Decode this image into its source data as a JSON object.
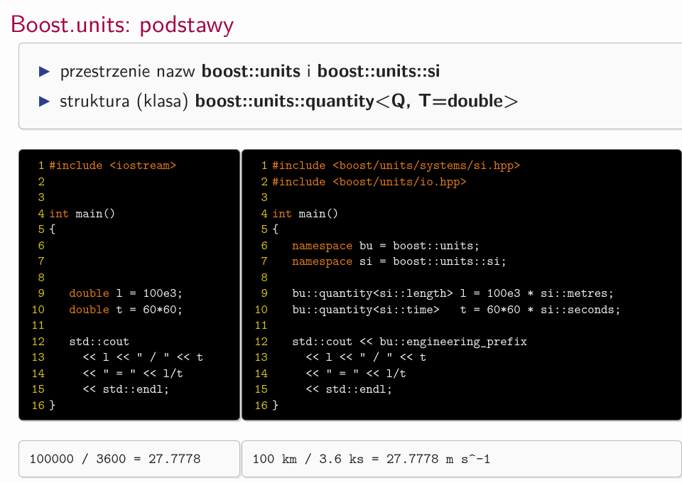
{
  "title": "Boost.units: podstawy",
  "bullets": {
    "b1_pre": "przestrzenie nazw ",
    "b1_bold_a": "boost::units",
    "b1_mid": " i ",
    "b1_bold_b": "boost::units::si",
    "b2_pre": "struktura (klasa) ",
    "b2_bold": "boost::units::quantity<Q, T=double>"
  },
  "code_left_lines": [
    {
      "n": "1",
      "kind": "kw",
      "text": "#include <iostream>"
    },
    {
      "n": "2",
      "kind": "txt",
      "text": ""
    },
    {
      "n": "3",
      "kind": "txt",
      "text": ""
    },
    {
      "n": "4",
      "kind": "mix",
      "pre_kw": "int",
      "rest": " main()"
    },
    {
      "n": "5",
      "kind": "txt",
      "text": "{"
    },
    {
      "n": "6",
      "kind": "txt",
      "text": ""
    },
    {
      "n": "7",
      "kind": "txt",
      "text": ""
    },
    {
      "n": "8",
      "kind": "txt",
      "text": ""
    },
    {
      "n": "9",
      "kind": "mix",
      "pre": "   ",
      "pre_kw": "double",
      "rest": " l = 100e3;"
    },
    {
      "n": "10",
      "kind": "mix",
      "pre": "   ",
      "pre_kw": "double",
      "rest": " t = 60*60;"
    },
    {
      "n": "11",
      "kind": "txt",
      "text": ""
    },
    {
      "n": "12",
      "kind": "txt",
      "text": "   std::cout"
    },
    {
      "n": "13",
      "kind": "txt",
      "text": "     << l << \" / \" << t"
    },
    {
      "n": "14",
      "kind": "txt",
      "text": "     << \" = \" << l/t"
    },
    {
      "n": "15",
      "kind": "txt",
      "text": "     << std::endl;"
    },
    {
      "n": "16",
      "kind": "txt",
      "text": "}"
    }
  ],
  "code_right_lines": [
    {
      "n": "1",
      "kind": "kw",
      "text": "#include <boost/units/systems/si.hpp>"
    },
    {
      "n": "2",
      "kind": "kw",
      "text": "#include <boost/units/io.hpp>"
    },
    {
      "n": "3",
      "kind": "txt",
      "text": ""
    },
    {
      "n": "4",
      "kind": "mix",
      "pre_kw": "int",
      "rest": " main()"
    },
    {
      "n": "5",
      "kind": "txt",
      "text": "{"
    },
    {
      "n": "6",
      "kind": "mix",
      "pre": "   ",
      "pre_kw": "namespace",
      "rest": " bu = boost::units;"
    },
    {
      "n": "7",
      "kind": "mix",
      "pre": "   ",
      "pre_kw": "namespace",
      "rest": " si = boost::units::si;"
    },
    {
      "n": "8",
      "kind": "txt",
      "text": ""
    },
    {
      "n": "9",
      "kind": "txt",
      "text": "   bu::quantity<si::length> l = 100e3 * si::metres;"
    },
    {
      "n": "10",
      "kind": "txt",
      "text": "   bu::quantity<si::time>   t = 60*60 * si::seconds;"
    },
    {
      "n": "11",
      "kind": "txt",
      "text": ""
    },
    {
      "n": "12",
      "kind": "txt",
      "text": "   std::cout << bu::engineering_prefix"
    },
    {
      "n": "13",
      "kind": "txt",
      "text": "     << l << \" / \" << t"
    },
    {
      "n": "14",
      "kind": "txt",
      "text": "     << \" = \" << l/t"
    },
    {
      "n": "15",
      "kind": "txt",
      "text": "     << std::endl;"
    },
    {
      "n": "16",
      "kind": "txt",
      "text": "}"
    }
  ],
  "output": {
    "left": "100000 / 3600 = 27.7778",
    "right": "100 km / 3.6 ks = 27.7778 m s^-1"
  }
}
